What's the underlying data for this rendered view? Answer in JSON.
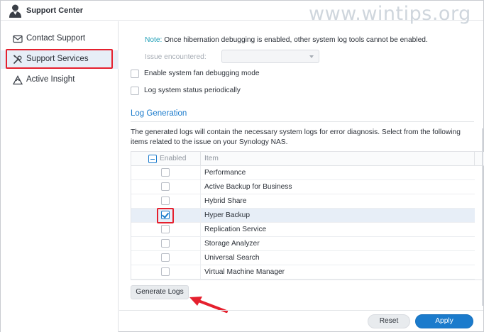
{
  "window": {
    "title": "Support Center",
    "watermark": "www.wintips.org"
  },
  "sidebar": {
    "items": [
      {
        "label": "Contact Support",
        "icon": "envelope-icon"
      },
      {
        "label": "Support Services",
        "icon": "tools-icon",
        "active": true
      },
      {
        "label": "Active Insight",
        "icon": "insight-icon"
      }
    ]
  },
  "main": {
    "note_prefix": "Note:",
    "note_text": " Once hibernation debugging is enabled, other system log tools cannot be enabled.",
    "issue_label": "Issue encountered:",
    "issue_value": "",
    "options": [
      {
        "label": "Enable system fan debugging mode",
        "checked": false
      },
      {
        "label": "Log system status periodically",
        "checked": false
      }
    ],
    "log_section": {
      "title": "Log Generation",
      "description": "The generated logs will contain the necessary system logs for error diagnosis. Select from the following items related to the issue on your Synology NAS.",
      "table": {
        "headers": {
          "enabled": "Enabled",
          "item": "Item"
        },
        "rows": [
          {
            "item": "Performance",
            "enabled": false
          },
          {
            "item": "Active Backup for Business",
            "enabled": false
          },
          {
            "item": "Hybrid Share",
            "enabled": false
          },
          {
            "item": "Hyper Backup",
            "enabled": true
          },
          {
            "item": "Replication Service",
            "enabled": false
          },
          {
            "item": "Storage Analyzer",
            "enabled": false
          },
          {
            "item": "Universal Search",
            "enabled": false
          },
          {
            "item": "Virtual Machine Manager",
            "enabled": false
          }
        ]
      },
      "generate_label": "Generate Logs"
    }
  },
  "footer": {
    "reset_label": "Reset",
    "apply_label": "Apply"
  },
  "colors": {
    "accent": "#1b7bcc",
    "highlight": "#e5202e",
    "note": "#1e9fb7"
  }
}
